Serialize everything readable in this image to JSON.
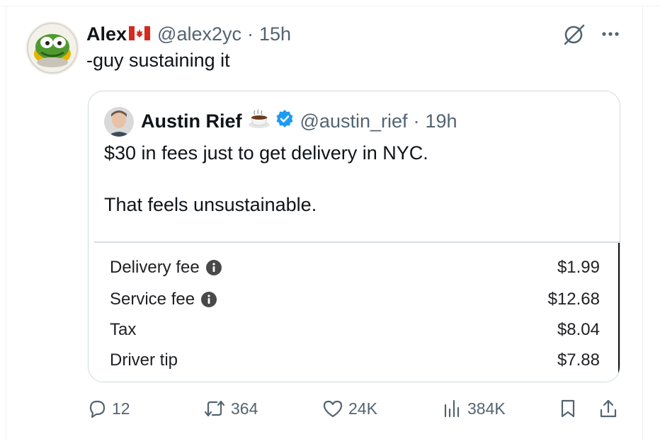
{
  "tweet": {
    "author_name": "Alex",
    "author_handle": "@alex2yc",
    "separator": "·",
    "time": "15h",
    "text": "-guy sustaining it"
  },
  "quote": {
    "author_name": "Austin Rief",
    "author_handle": "@austin_rief",
    "separator": "·",
    "time": "19h",
    "text_line1": "$30 in fees just to get delivery in NYC.",
    "text_line2": "That feels unsustainable.",
    "receipt": {
      "rows": [
        {
          "label": "Delivery fee",
          "amount": "$1.99",
          "info": true
        },
        {
          "label": "Service fee",
          "amount": "$12.68",
          "info": true
        },
        {
          "label": "Tax",
          "amount": "$8.04",
          "info": false
        },
        {
          "label": "Driver tip",
          "amount": "$7.88",
          "info": false
        }
      ]
    }
  },
  "actions": {
    "replies": "12",
    "reposts": "364",
    "likes": "24K",
    "views": "384K"
  },
  "icons": [
    "canada-flag-icon",
    "grok-icon",
    "more-icon",
    "coffee-icon",
    "verified-badge-icon",
    "info-icon",
    "reply-icon",
    "repost-icon",
    "like-icon",
    "views-icon",
    "bookmark-icon",
    "share-icon"
  ],
  "colors": {
    "text": "#0f1419",
    "secondary": "#536471",
    "border": "#cfd9de",
    "verified": "#1d9bf0"
  }
}
